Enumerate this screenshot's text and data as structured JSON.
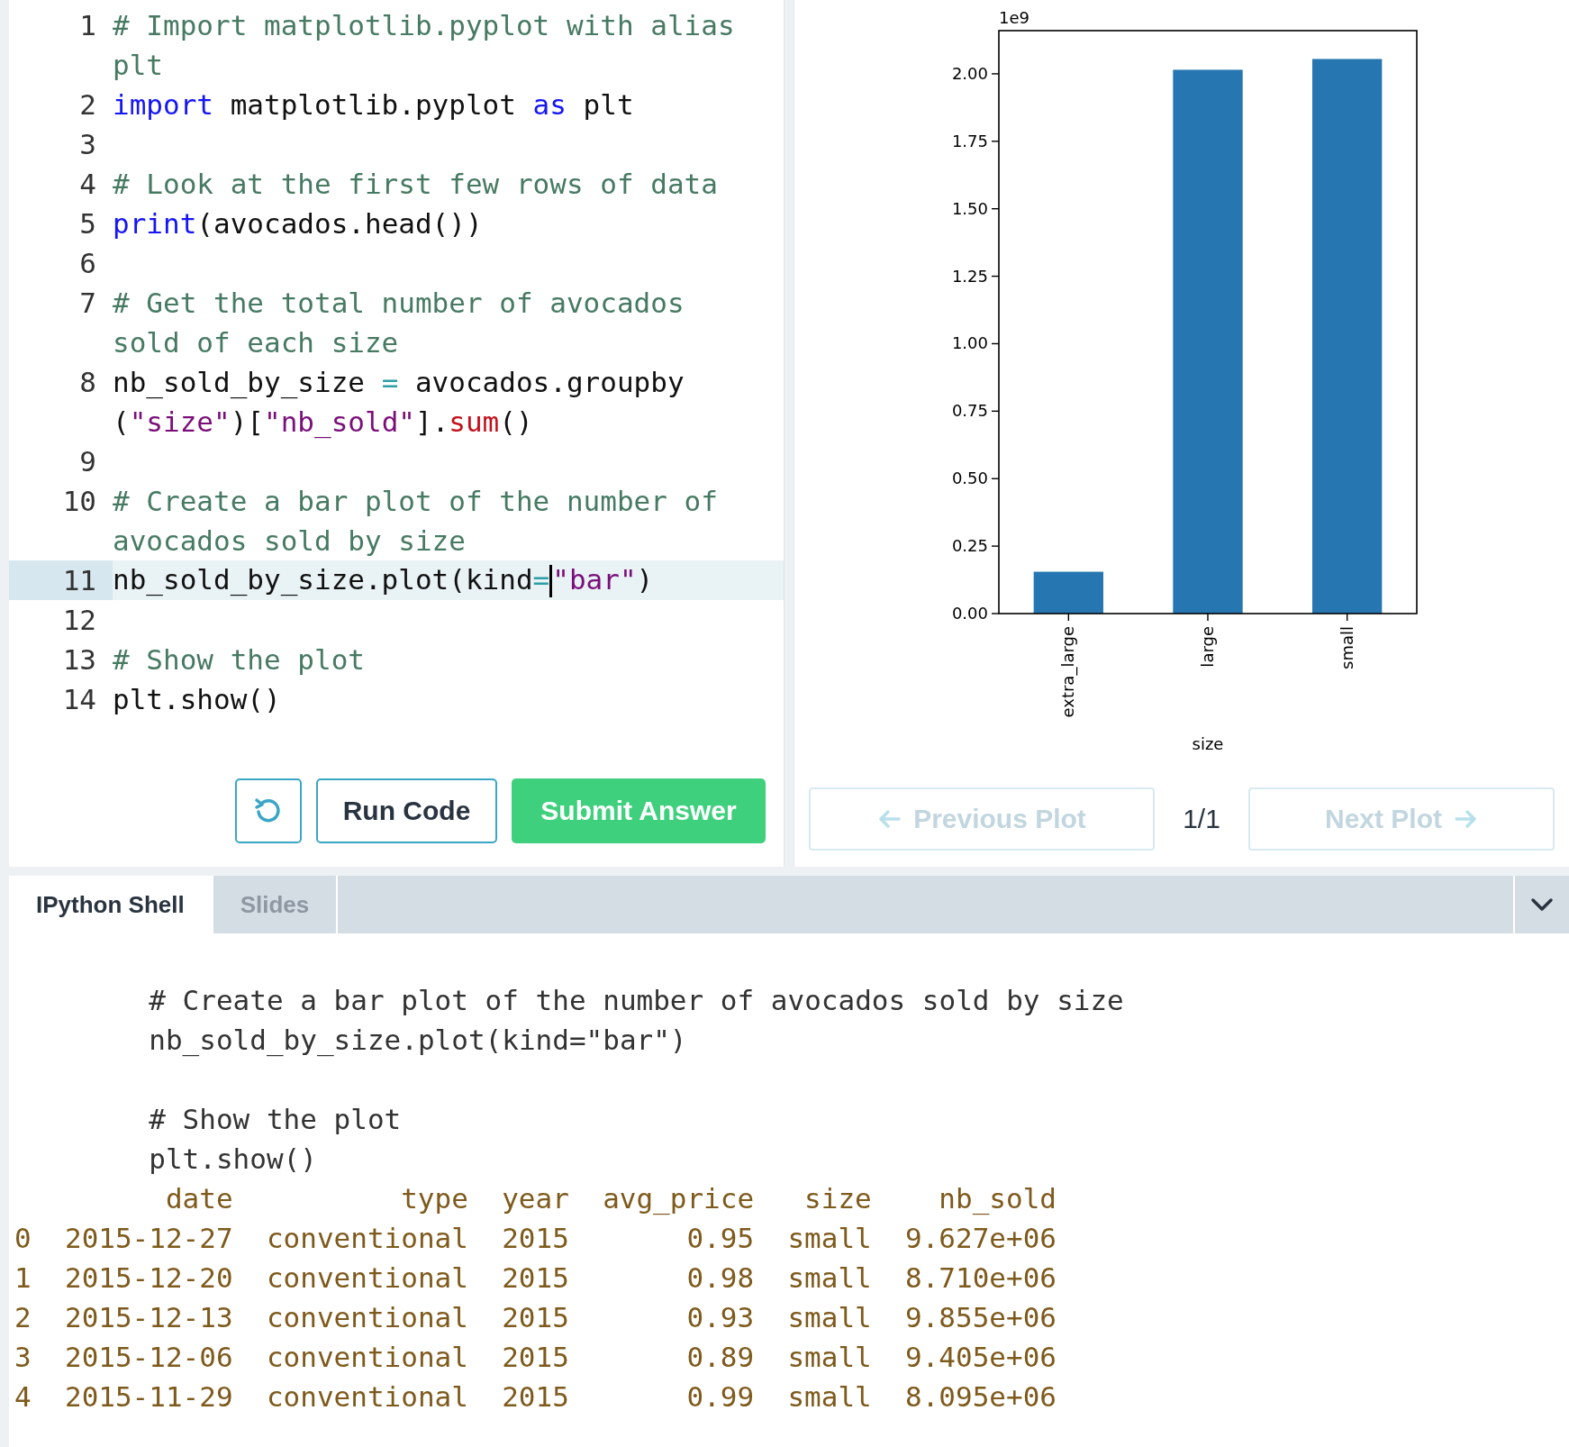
{
  "editor": {
    "lines": [
      {
        "number": "1",
        "active": false,
        "visual_lines": [
          {
            "segments": [
              {
                "kind": "comment",
                "text": "# Import matplotlib.pyplot with alias"
              }
            ]
          },
          {
            "segments": [
              {
                "kind": "comment",
                "text": "plt"
              }
            ]
          }
        ]
      },
      {
        "number": "2",
        "active": false,
        "visual_lines": [
          {
            "segments": [
              {
                "kind": "keyword",
                "text": "import"
              },
              {
                "kind": "plain",
                "text": " matplotlib.pyplot "
              },
              {
                "kind": "keyword",
                "text": "as"
              },
              {
                "kind": "plain",
                "text": " plt"
              }
            ]
          }
        ]
      },
      {
        "number": "3",
        "active": false
      },
      {
        "number": "4",
        "active": false,
        "visual_lines": [
          {
            "segments": [
              {
                "kind": "comment",
                "text": "# Look at the first few rows of data"
              }
            ]
          }
        ]
      },
      {
        "number": "5",
        "active": false,
        "visual_lines": [
          {
            "segments": [
              {
                "kind": "keyword",
                "text": "print"
              },
              {
                "kind": "plain",
                "text": "(avocados.head())"
              }
            ]
          }
        ]
      },
      {
        "number": "6",
        "active": false
      },
      {
        "number": "7",
        "active": false,
        "visual_lines": [
          {
            "segments": [
              {
                "kind": "comment",
                "text": "# Get the total number of avocados"
              }
            ]
          },
          {
            "segments": [
              {
                "kind": "comment",
                "text": "sold of each size"
              }
            ]
          }
        ]
      },
      {
        "number": "8",
        "active": false,
        "visual_lines": [
          {
            "segments": [
              {
                "kind": "plain",
                "text": "nb_sold_by_size "
              },
              {
                "kind": "operator",
                "text": "="
              },
              {
                "kind": "plain",
                "text": " avocados.groupby"
              }
            ]
          },
          {
            "segments": [
              {
                "kind": "plain",
                "text": "("
              },
              {
                "kind": "string",
                "text": "\"size\""
              },
              {
                "kind": "plain",
                "text": ")["
              },
              {
                "kind": "string",
                "text": "\"nb_sold\""
              },
              {
                "kind": "plain",
                "text": "]."
              },
              {
                "kind": "method",
                "text": "sum"
              },
              {
                "kind": "plain",
                "text": "()"
              }
            ]
          }
        ]
      },
      {
        "number": "9",
        "active": false
      },
      {
        "number": "10",
        "active": false,
        "visual_lines": [
          {
            "segments": [
              {
                "kind": "comment",
                "text": "# Create a bar plot of the number of"
              }
            ]
          },
          {
            "segments": [
              {
                "kind": "comment",
                "text": "avocados sold by size"
              }
            ]
          }
        ]
      },
      {
        "number": "11",
        "active": true,
        "visual_lines": [
          {
            "segments": [
              {
                "kind": "plain",
                "text": "nb_sold_by_size.plot(kind"
              },
              {
                "kind": "operator",
                "text": "="
              },
              {
                "kind": "cursor"
              },
              {
                "kind": "string",
                "text": "\"bar\""
              },
              {
                "kind": "plain",
                "text": ")"
              }
            ]
          }
        ]
      },
      {
        "number": "12",
        "active": false
      },
      {
        "number": "13",
        "active": false,
        "visual_lines": [
          {
            "segments": [
              {
                "kind": "comment",
                "text": "# Show the plot"
              }
            ]
          }
        ]
      },
      {
        "number": "14",
        "active": false,
        "visual_lines": [
          {
            "segments": [
              {
                "kind": "plain",
                "text": "plt.show()"
              }
            ]
          }
        ]
      }
    ],
    "buttons": [
      {
        "kind": "reset"
      },
      {
        "kind": "run",
        "label": "Run Code"
      },
      {
        "kind": "submit",
        "label": "Submit Answer"
      }
    ]
  },
  "plot": {
    "offset_label": "1e9",
    "chart_data": {
      "type": "bar",
      "xlabel": "size",
      "categories": [
        "extra_large",
        "large",
        "small"
      ],
      "values": [
        0.155,
        2.015,
        2.055
      ],
      "ylim": [
        0,
        2.16
      ],
      "yticks": [
        {
          "value": 0,
          "label": "0.00"
        },
        {
          "value": 0.25,
          "label": "0.25"
        },
        {
          "value": 0.5,
          "label": "0.50"
        },
        {
          "value": 0.75,
          "label": "0.75"
        },
        {
          "value": 1,
          "label": "1.00"
        },
        {
          "value": 1.25,
          "label": "1.25"
        },
        {
          "value": 1.5,
          "label": "1.50"
        },
        {
          "value": 1.75,
          "label": "1.75"
        },
        {
          "value": 2,
          "label": "2.00"
        }
      ]
    },
    "nav": {
      "previous": {
        "label": "Previous Plot",
        "disabled": true
      },
      "counter": "1/1",
      "next": {
        "label": "Next Plot",
        "disabled": true
      }
    }
  },
  "shell": {
    "tabs": [
      {
        "label": "IPython Shell",
        "selected": true
      },
      {
        "label": "Slides",
        "selected": false
      }
    ],
    "echo": [
      [
        "# Create a bar plot of the number of avocados sold by size",
        "nb_sold_by_size.plot(kind=\"bar\")"
      ],
      [
        "# Show the plot",
        "plt.show()"
      ]
    ],
    "table": {
      "columns": [
        "date",
        "type",
        "year",
        "avg_price",
        "size",
        "nb_sold"
      ],
      "rows": [
        {
          "index": "0",
          "cells": [
            "2015-12-27",
            "conventional",
            "2015",
            "0.95",
            "small",
            "9.627e+06"
          ]
        },
        {
          "index": "1",
          "cells": [
            "2015-12-20",
            "conventional",
            "2015",
            "0.98",
            "small",
            "8.710e+06"
          ]
        },
        {
          "index": "2",
          "cells": [
            "2015-12-13",
            "conventional",
            "2015",
            "0.93",
            "small",
            "9.855e+06"
          ]
        },
        {
          "index": "3",
          "cells": [
            "2015-12-06",
            "conventional",
            "2015",
            "0.89",
            "small",
            "9.405e+06"
          ]
        },
        {
          "index": "4",
          "cells": [
            "2015-11-29",
            "conventional",
            "2015",
            "0.99",
            "small",
            "8.095e+06"
          ]
        }
      ]
    }
  }
}
